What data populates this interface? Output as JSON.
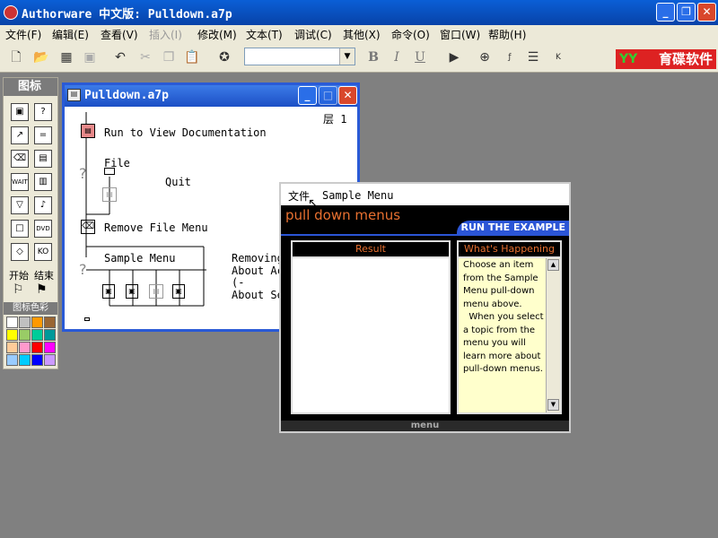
{
  "window": {
    "title": "Authorware 中文版: Pulldown.a7p"
  },
  "menubar": [
    "文件(F)",
    "编辑(E)",
    "查看(V)",
    "插入(I)",
    "修改(M)",
    "文本(T)",
    "调试(C)",
    "其他(X)",
    "命令(O)",
    "窗口(W)",
    "帮助(H)"
  ],
  "toolbar": {
    "bold": "B",
    "italic": "I",
    "underline": "U",
    "font_value": ""
  },
  "logo": {
    "text": "育碟软件"
  },
  "palette": {
    "title": "图标",
    "start_label": "开始",
    "end_label": "结束",
    "color_label": "图标色彩",
    "swatches": [
      "#ffffff",
      "#c0c0c0",
      "#ff9900",
      "#996633",
      "#ffff00",
      "#99cc66",
      "#00cc99",
      "#009999",
      "#ffcc99",
      "#ff99cc",
      "#ff0000",
      "#ff00ff",
      "#99ccff",
      "#00ccff",
      "#0000ff",
      "#cc99ff"
    ]
  },
  "flow_window": {
    "title": "Pulldown.a7p",
    "level": "层 1",
    "labels": {
      "run_doc": "Run to View Documentation",
      "file": "File",
      "quit": "Quit",
      "remove_file_menu": "Remove File Menu",
      "sample_menu": "Sample Menu",
      "removing": "Removing",
      "about_ac": "About Ac",
      "paren": "(-",
      "about_se": "About Se"
    }
  },
  "presentation": {
    "menu_file": "文件",
    "menu_sample": "Sample Menu",
    "heading": "pull down menus",
    "banner": "RUN THE EXAMPLE",
    "result_title": "Result",
    "happening_title": "What's Happening",
    "happening_text": "Choose an item from the Sample Menu pull-down menu above.\n  When you select a topic from the menu you will learn more about pull-down menus.",
    "footer": "menu"
  }
}
